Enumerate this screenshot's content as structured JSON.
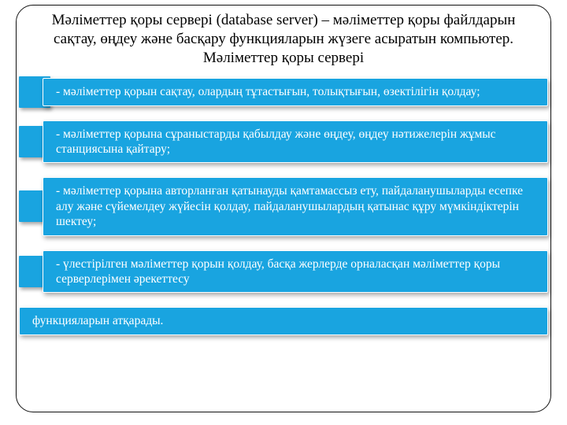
{
  "heading": "Мәліметтер қоры сервері (database server) – мәліметтер қоры файлдарын сақтау, өңдеу және басқару функцияларын жүзеге асыратын компьютер. Мәліметтер қоры сервері",
  "items": [
    {
      "text": "- мәліметтер қорын сақтау, олардың тұтастығын, толықтығын, өзектілігін қолдау;",
      "stub": true
    },
    {
      "text": "- мәліметтер қорына сұраныстарды қабылдау және өңдеу, өңдеу нәтижелерін жұмыс станциясына қайтару;",
      "stub": true
    },
    {
      "text": "- мәліметтер қорына авторланған қатынауды қамтамассыз ету, пайдаланушыларды есепке алу және сүйемелдеу жүйесін қолдау, пайдаланушылардың қатынас құру мүмкіндіктерін шектеу;",
      "stub": true
    },
    {
      "text": "- үлестірілген мәліметтер қорын қолдау, басқа жерлерде орналасқан мәліметтер қоры серверлерімен әрекеттесу",
      "stub": true
    },
    {
      "text": "функцияларын атқарады.",
      "stub": false
    }
  ]
}
